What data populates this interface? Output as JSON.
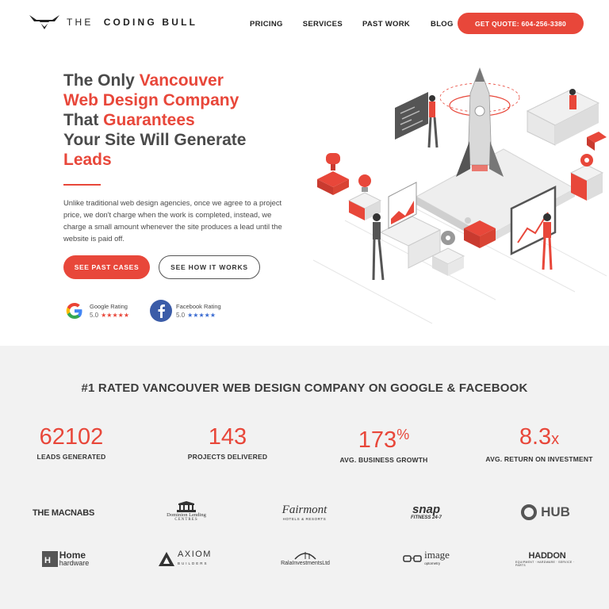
{
  "header": {
    "logo_text_light": "THE",
    "logo_text_bold": "CODING BULL",
    "nav": [
      {
        "label": "PRICING"
      },
      {
        "label": "SERVICES"
      },
      {
        "label": "PAST WORK"
      },
      {
        "label": "BLOG"
      }
    ],
    "quote_button": "GET QUOTE: 604-256-3380"
  },
  "hero": {
    "headline": {
      "l1a": "The Only ",
      "l1b": "Vancouver",
      "l2": "Web Design Company",
      "l3a": "That ",
      "l3b": "Guarantees",
      "l4": "Your Site Will Generate",
      "l5": "Leads"
    },
    "intro": "Unlike traditional web design agencies, once we agree to a project price, we don't charge when the work is completed, instead, we charge a small amount whenever the site produces a lead until the website is paid off.",
    "primary_button": "SEE PAST CASES",
    "secondary_button": "SEE HOW IT WORKS",
    "ratings": [
      {
        "source": "Google Rating",
        "score": "5.0",
        "stars": "★★★★★"
      },
      {
        "source": "Facebook Rating",
        "score": "5.0",
        "stars": "★★★★★"
      }
    ]
  },
  "stats": {
    "title": "#1 RATED VANCOUVER WEB DESIGN COMPANY ON GOOGLE & FACEBOOK",
    "items": [
      {
        "value": "62102",
        "suffix": "",
        "label": "LEADS GENERATED"
      },
      {
        "value": "143",
        "suffix": "",
        "label": "PROJECTS DELIVERED"
      },
      {
        "value": "173",
        "suffix": "%",
        "label": "AVG. BUSINESS GROWTH"
      },
      {
        "value": "8.3",
        "suffix": "x",
        "label": "AVG. RETURN ON INVESTMENT"
      }
    ]
  },
  "clients": {
    "macnabs": "THE MACNABS",
    "dominion_1": "Dominion Lending",
    "dominion_2": "CENTRES",
    "fairmont": "Fairmont",
    "fairmont_sub": "HOTELS & RESORTS",
    "snap_1": "snap",
    "snap_2": "FITNESS 24-7",
    "hub": "HUB",
    "home_1": "Home",
    "home_2": "hardware",
    "axiom": "AXIOM",
    "axiom_sub": "BUILDERS",
    "rala": "RalaInvestmentsLtd",
    "image": "image",
    "image_sub": "optometry",
    "haddon": "HADDON",
    "haddon_sub": "EQUIPMENT · HARDWARE · SERVICE · PARTS"
  },
  "colors": {
    "accent": "#e8473a",
    "section_bg": "#f2f2f2",
    "text": "#4a4a4a"
  }
}
